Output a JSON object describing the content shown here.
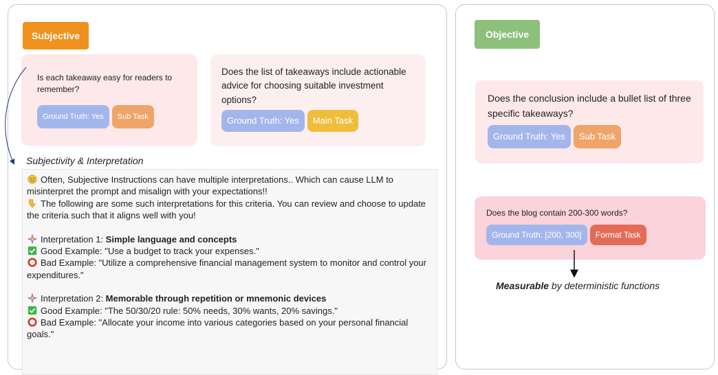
{
  "subjective": {
    "header": "Subjective",
    "cards": [
      {
        "question": "Is each takeaway easy for readers to remember?",
        "ground_truth": "Ground Truth: Yes",
        "task": "Sub Task"
      },
      {
        "question": "Does the list of takeaways include actionable advice for choosing suitable investment options?",
        "ground_truth": "Ground Truth: Yes",
        "task": "Main Task"
      }
    ],
    "interpretation_title": "Subjectivity & Interpretation",
    "interpretation": {
      "intro1": "Often, Subjective Instructions can have multiple interpretations.. Which can cause LLM to misinterpret the prompt and misalign with your expectations!!",
      "intro2": "The following are some such interpretations for this criteria. You can review and choose to update the criteria such that it aligns well with you!",
      "items": [
        {
          "label": "Interpretation 1: ",
          "name": "Simple language and concepts",
          "good": "Good Example: \"Use a budget to track your expenses.\"",
          "bad": "Bad Example: \"Utilize a comprehensive financial management system to monitor and control your expenditures.\""
        },
        {
          "label": "Interpretation 2: ",
          "name": "Memorable through repetition or mnemonic devices",
          "good": "Good Example: \"The 50/30/20 rule: 50% needs, 30% wants, 20% savings.\"",
          "bad": "Bad Example: \"Allocate your income into various categories based on your personal financial goals.\""
        }
      ]
    }
  },
  "objective": {
    "header": "Objective",
    "cards": [
      {
        "question": "Does the conclusion include a bullet list of three specific takeaways?",
        "ground_truth": "Ground Truth: Yes",
        "task": "Sub Task"
      },
      {
        "question": "Does the blog contain 200-300 words?",
        "ground_truth": "Ground Truth: [200, 300]",
        "task": "Format Task"
      }
    ],
    "caption_bold": "Measurable",
    "caption_rest": " by deterministic functions"
  },
  "colors": {
    "subjective": "#f0911d",
    "objective": "#8cc07b",
    "ground_truth_tag": "#a3b6ec",
    "sub_task_tag": "#efa469",
    "main_task_tag": "#efbd3c",
    "format_task_tag": "#e26c58"
  },
  "icons": [
    "confused-face-icon",
    "pointing-hand-icon",
    "sparkle-icon",
    "check-mark-icon",
    "cross-circle-icon",
    "arrow-icon"
  ]
}
